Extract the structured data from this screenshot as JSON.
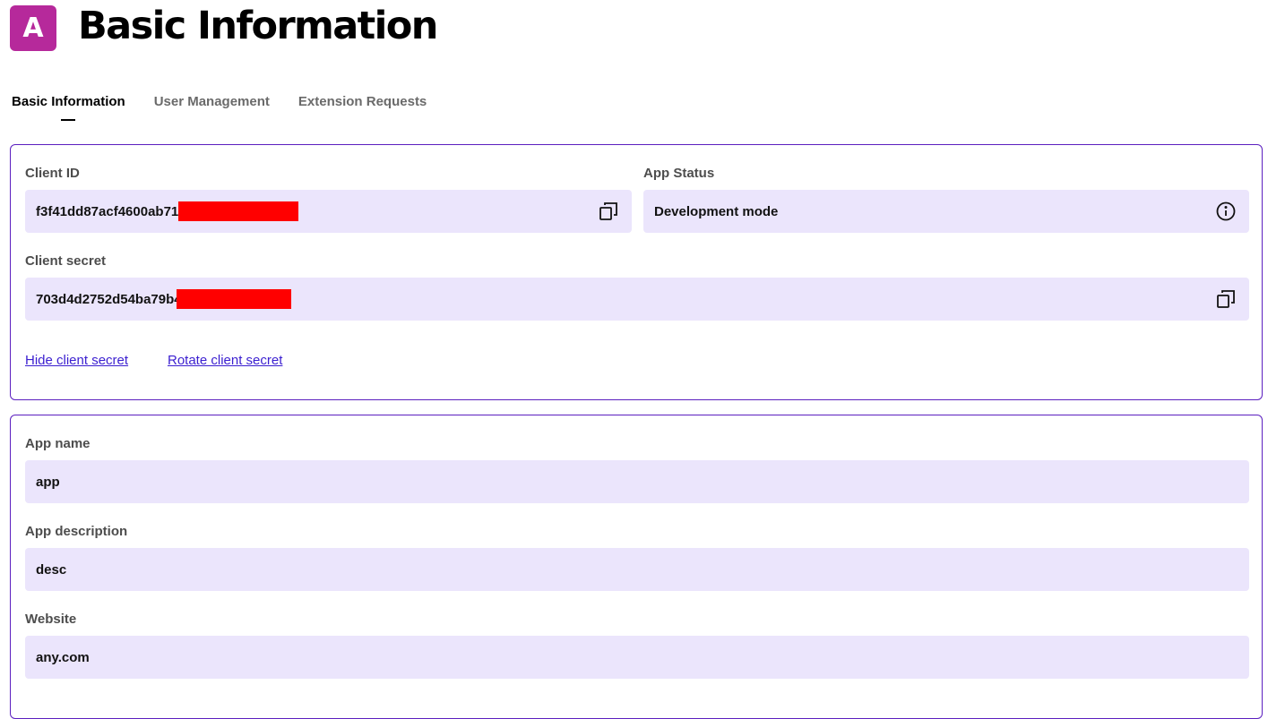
{
  "app": {
    "avatar_letter": "A",
    "title": "Basic Information"
  },
  "tabs": [
    {
      "label": "Basic Information",
      "active": true
    },
    {
      "label": "User Management",
      "active": false
    },
    {
      "label": "Extension Requests",
      "active": false
    }
  ],
  "credentials": {
    "client_id_label": "Client ID",
    "client_id_value": "f3f41dd87acf4600ab71",
    "app_status_label": "App Status",
    "app_status_value": "Development mode",
    "client_secret_label": "Client secret",
    "client_secret_value": "703d4d2752d54ba79b4",
    "hide_secret_link": "Hide client secret",
    "rotate_secret_link": "Rotate client secret"
  },
  "details": {
    "app_name_label": "App name",
    "app_name_value": "app",
    "app_description_label": "App description",
    "app_description_value": "desc",
    "website_label": "Website",
    "website_value": "any.com"
  },
  "colors": {
    "avatar": "#b6299b",
    "card_border": "#5b1fbf",
    "field_bg": "#ebe5fc",
    "link": "#3b1fd0",
    "redaction": "#ff0000"
  },
  "icons": [
    "copy-icon",
    "info-icon"
  ]
}
